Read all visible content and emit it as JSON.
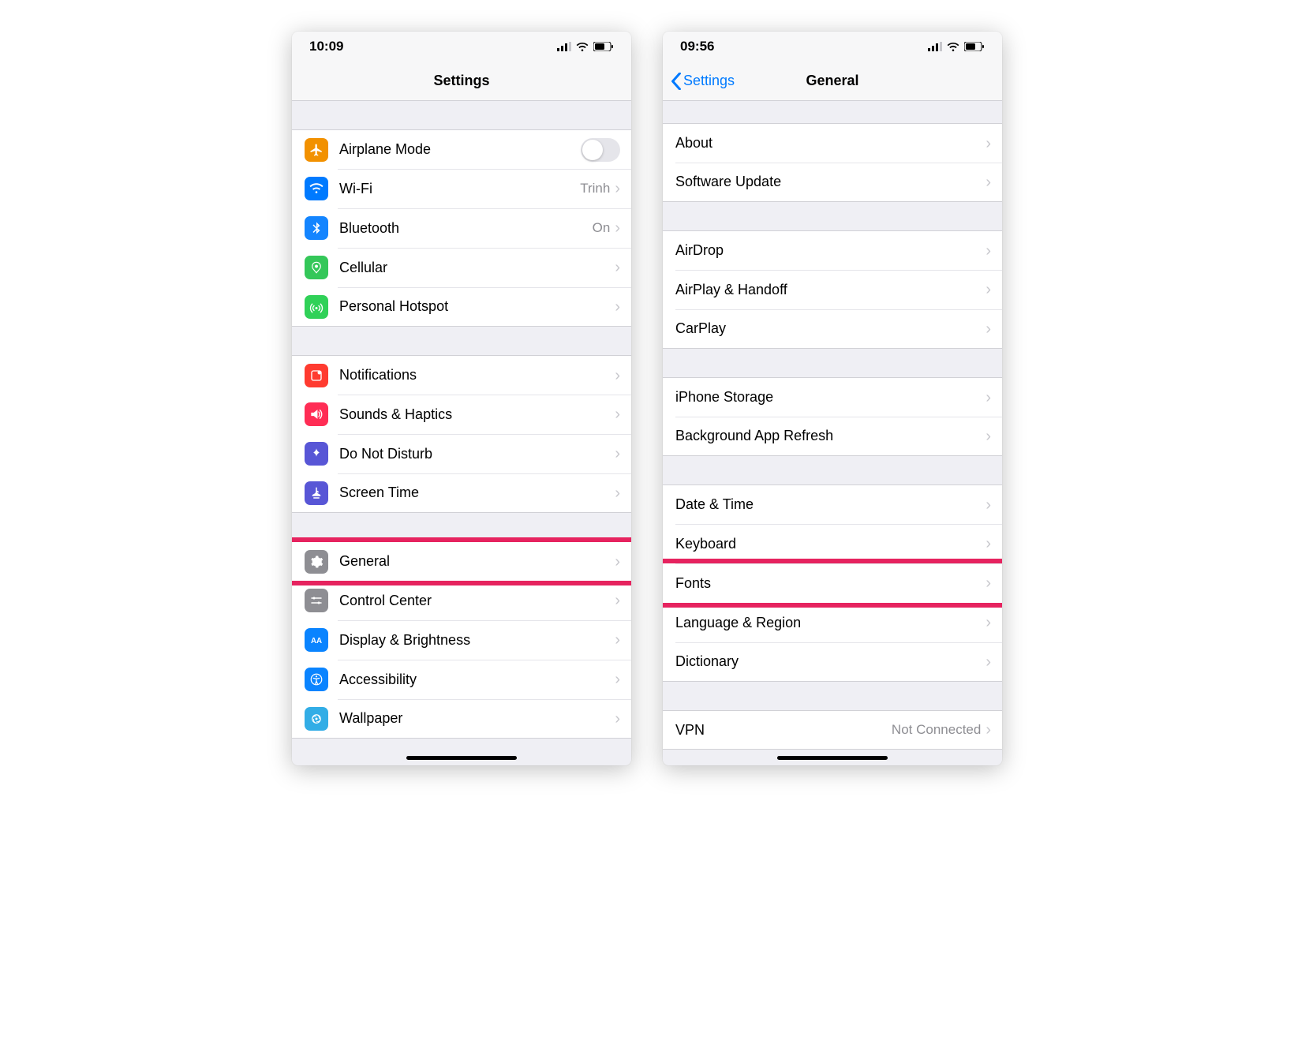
{
  "left": {
    "time": "10:09",
    "title": "Settings",
    "groups": [
      [
        {
          "icon": "airplane-icon",
          "label": "Airplane Mode",
          "toggle": true
        },
        {
          "icon": "wifi-icon",
          "label": "Wi-Fi",
          "value": "Trinh",
          "chev": true
        },
        {
          "icon": "bluetooth-icon",
          "label": "Bluetooth",
          "value": "On",
          "chev": true
        },
        {
          "icon": "cellular-icon",
          "label": "Cellular",
          "chev": true
        },
        {
          "icon": "hotspot-icon",
          "label": "Personal Hotspot",
          "chev": true
        }
      ],
      [
        {
          "icon": "notifications-icon",
          "label": "Notifications",
          "chev": true
        },
        {
          "icon": "sounds-icon",
          "label": "Sounds & Haptics",
          "chev": true
        },
        {
          "icon": "dnd-icon",
          "label": "Do Not Disturb",
          "chev": true
        },
        {
          "icon": "screentime-icon",
          "label": "Screen Time",
          "chev": true
        }
      ],
      [
        {
          "icon": "general-icon",
          "label": "General",
          "chev": true,
          "highlight": true
        },
        {
          "icon": "controlcenter-icon",
          "label": "Control Center",
          "chev": true
        },
        {
          "icon": "display-icon",
          "label": "Display & Brightness",
          "chev": true
        },
        {
          "icon": "accessibility-icon",
          "label": "Accessibility",
          "chev": true
        },
        {
          "icon": "wallpaper-icon",
          "label": "Wallpaper",
          "chev": true
        }
      ]
    ]
  },
  "right": {
    "time": "09:56",
    "back": "Settings",
    "title": "General",
    "groups": [
      [
        {
          "label": "About",
          "chev": true
        },
        {
          "label": "Software Update",
          "chev": true
        }
      ],
      [
        {
          "label": "AirDrop",
          "chev": true
        },
        {
          "label": "AirPlay & Handoff",
          "chev": true
        },
        {
          "label": "CarPlay",
          "chev": true
        }
      ],
      [
        {
          "label": "iPhone Storage",
          "chev": true
        },
        {
          "label": "Background App Refresh",
          "chev": true
        }
      ],
      [
        {
          "label": "Date & Time",
          "chev": true
        },
        {
          "label": "Keyboard",
          "chev": true
        },
        {
          "label": "Fonts",
          "chev": true,
          "highlight": true
        },
        {
          "label": "Language & Region",
          "chev": true
        },
        {
          "label": "Dictionary",
          "chev": true
        }
      ],
      [
        {
          "label": "VPN",
          "value": "Not Connected",
          "chev": true
        }
      ]
    ]
  },
  "iconColors": {
    "airplane-icon": "c-orange",
    "wifi-icon": "c-blue",
    "bluetooth-icon": "c-btblue",
    "cellular-icon": "c-green",
    "hotspot-icon": "c-green2",
    "notifications-icon": "c-red",
    "sounds-icon": "c-pink",
    "dnd-icon": "c-purple",
    "screentime-icon": "c-purple",
    "general-icon": "c-gray",
    "controlcenter-icon": "c-gray",
    "display-icon": "c-aablue",
    "accessibility-icon": "c-aablue",
    "wallpaper-icon": "c-teal"
  }
}
